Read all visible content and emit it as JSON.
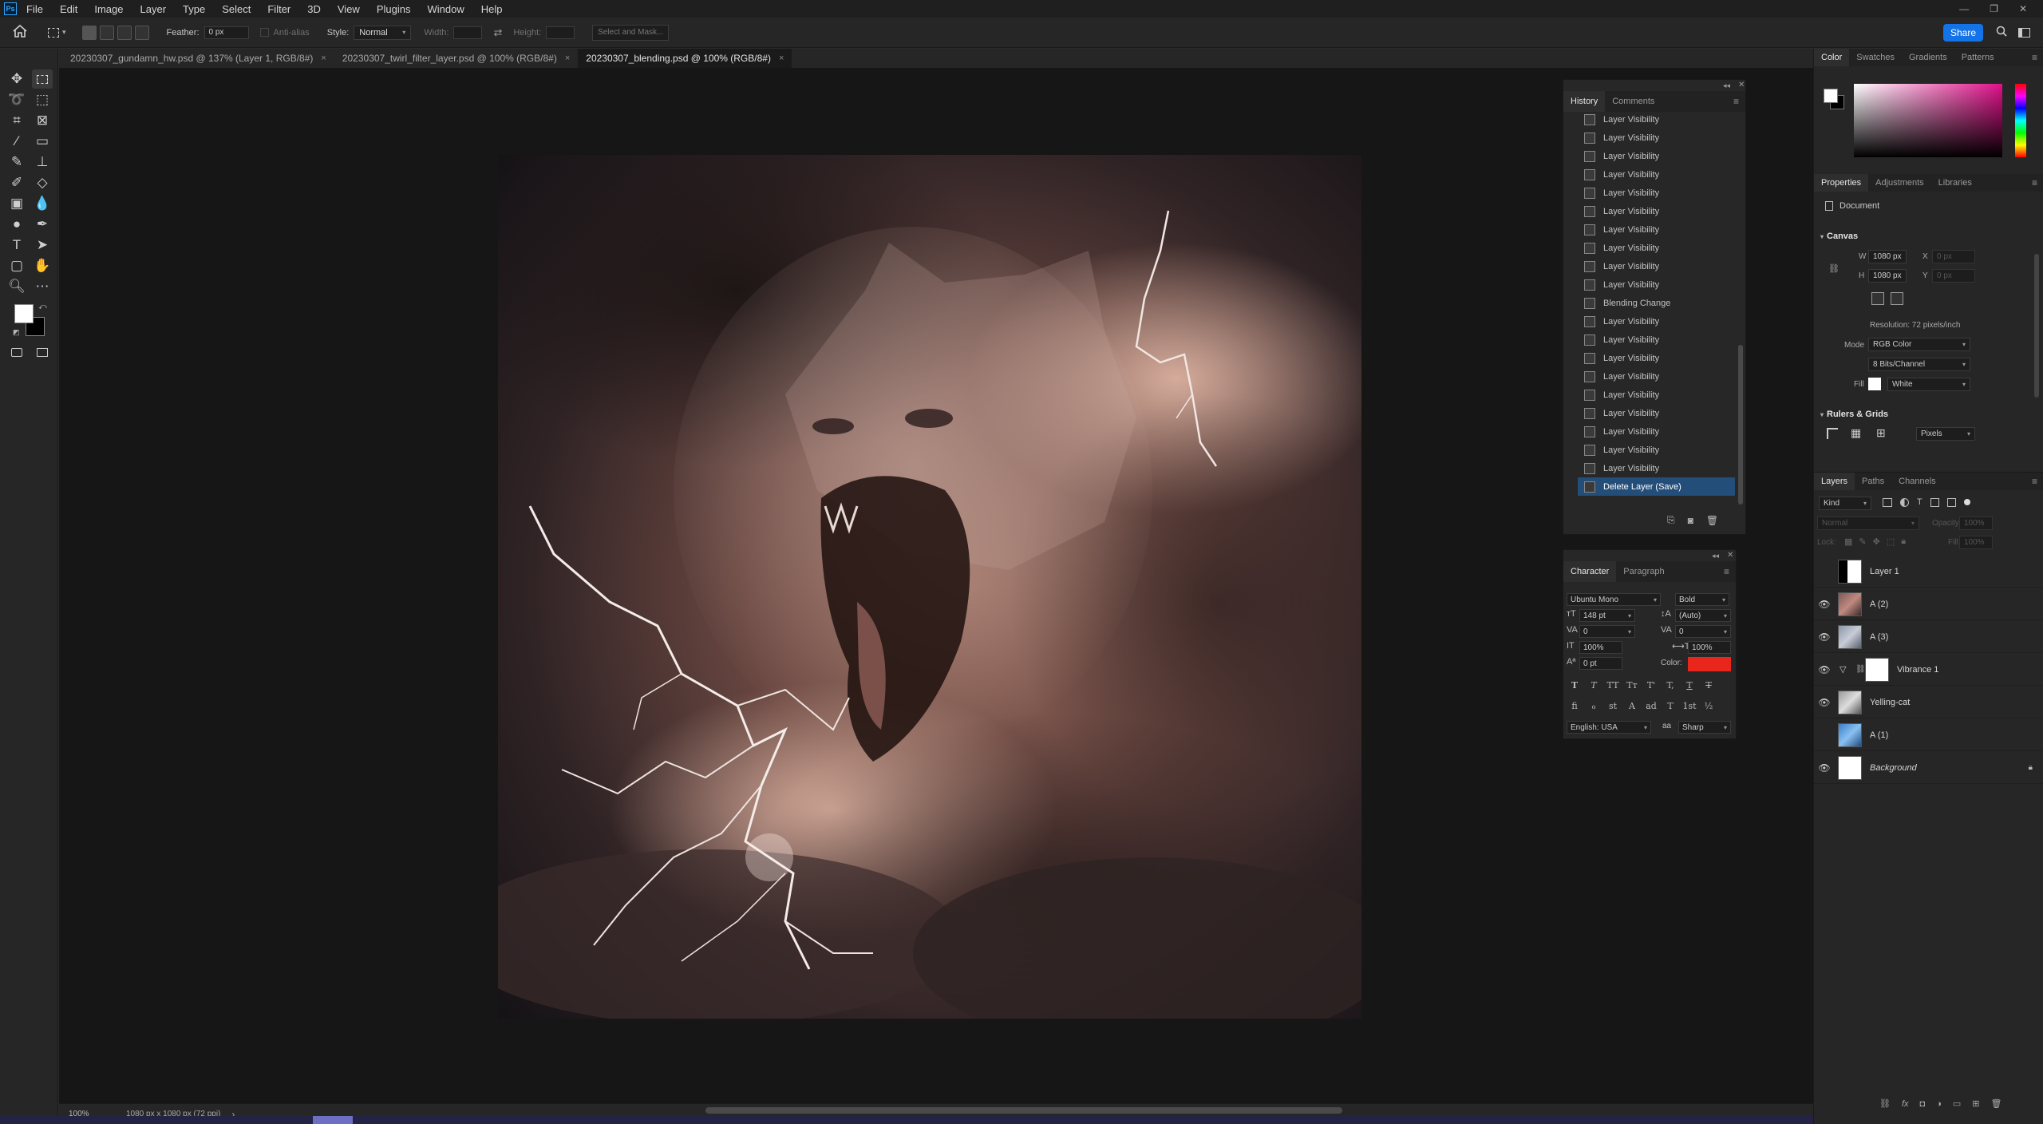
{
  "app": {
    "logo": "Ps"
  },
  "menu": [
    "File",
    "Edit",
    "Image",
    "Layer",
    "Type",
    "Select",
    "Filter",
    "3D",
    "View",
    "Plugins",
    "Window",
    "Help"
  ],
  "window_controls": {
    "minimize": "—",
    "restore": "❐",
    "close": "✕"
  },
  "options": {
    "feather_label": "Feather:",
    "feather_value": "0 px",
    "antialias_label": "Anti-alias",
    "style_label": "Style:",
    "style_value": "Normal",
    "width_label": "Width:",
    "height_label": "Height:",
    "select_mask": "Select and Mask...",
    "share": "Share"
  },
  "tabs": [
    {
      "label": "20230307_gundamn_hw.psd @ 137% (Layer 1, RGB/8#)",
      "close": "×"
    },
    {
      "label": "20230307_twirl_filter_layer.psd @ 100% (RGB/8#)",
      "close": "×"
    },
    {
      "label": "20230307_blending.psd @ 100% (RGB/8#)",
      "close": "×"
    }
  ],
  "status": {
    "zoom": "100%",
    "doc_info": "1080 px x 1080 px (72 ppi)",
    "arrow": "›"
  },
  "history": {
    "tabs": [
      "History",
      "Comments"
    ],
    "items": [
      "Layer Visibility",
      "Layer Visibility",
      "Layer Visibility",
      "Layer Visibility",
      "Layer Visibility",
      "Layer Visibility",
      "Layer Visibility",
      "Layer Visibility",
      "Layer Visibility",
      "Layer Visibility",
      "Blending Change",
      "Layer Visibility",
      "Layer Visibility",
      "Layer Visibility",
      "Layer Visibility",
      "Layer Visibility",
      "Layer Visibility",
      "Layer Visibility",
      "Layer Visibility",
      "Layer Visibility",
      "Delete Layer (Save)"
    ]
  },
  "character": {
    "tabs": [
      "Character",
      "Paragraph"
    ],
    "font_family": "Ubuntu Mono",
    "font_style": "Bold",
    "size": "148 pt",
    "leading": "(Auto)",
    "kerning": "0",
    "tracking": "0",
    "vscale": "100%",
    "hscale": "100%",
    "baseline": "0 pt",
    "color_label": "Color:",
    "color": "#e8261c",
    "language": "English: USA",
    "aa_icon": "aa",
    "antialias": "Sharp",
    "toggles": [
      "T",
      "T",
      "TT",
      "Tт",
      "T'",
      "T,",
      "T",
      "T"
    ],
    "opentype": [
      "fi",
      "ℴ",
      "st",
      "A",
      "ad",
      "T",
      "1st",
      "½"
    ]
  },
  "color_panel": {
    "tabs": [
      "Color",
      "Swatches",
      "Gradients",
      "Patterns"
    ]
  },
  "properties": {
    "tabs": [
      "Properties",
      "Adjustments",
      "Libraries"
    ],
    "doc_label": "Document",
    "canvas_header": "Canvas",
    "w_label": "W",
    "w_value": "1080 px",
    "h_label": "H",
    "h_value": "1080 px",
    "x_label": "X",
    "x_value": "0 px",
    "y_label": "Y",
    "y_value": "0 px",
    "resolution": "Resolution: 72 pixels/inch",
    "mode_label": "Mode",
    "mode_value": "RGB Color",
    "depth_value": "8 Bits/Channel",
    "fill_label": "Fill",
    "fill_value": "White",
    "rulers_header": "Rulers & Grids",
    "units_value": "Pixels"
  },
  "layers_panel": {
    "tabs": [
      "Layers",
      "Paths",
      "Channels"
    ],
    "filter_kind": "Kind",
    "blend_mode": "Normal",
    "opacity_label": "Opacity:",
    "opacity_value": "100%",
    "lock_label": "Lock:",
    "fill_label": "Fill:",
    "fill_value": "100%",
    "layers": [
      {
        "name": "Layer 1",
        "visible": false
      },
      {
        "name": "A (2)",
        "visible": true
      },
      {
        "name": "A (3)",
        "visible": true
      },
      {
        "name": "Vibrance 1",
        "visible": true
      },
      {
        "name": "Yelling-cat",
        "visible": true
      },
      {
        "name": "A (1)",
        "visible": false
      },
      {
        "name": "Background",
        "visible": true
      }
    ]
  }
}
